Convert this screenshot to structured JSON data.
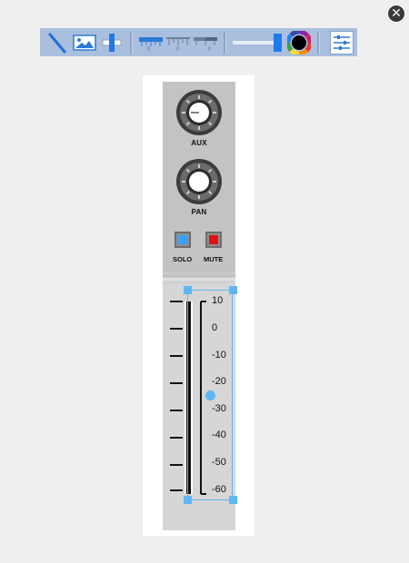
{
  "window": {
    "close_icon": "close-circle-icon"
  },
  "toolbar": {
    "tools": [
      {
        "name": "line-tool",
        "icon": "diagonal-line-icon"
      },
      {
        "name": "image-tool",
        "icon": "image-icon"
      },
      {
        "name": "slider-tool",
        "icon": "slider-icon"
      },
      {
        "name": "ruler-tool-1",
        "icon": "ruler-icon"
      },
      {
        "name": "ruler-tool-2",
        "icon": "ruler-icon"
      },
      {
        "name": "ruler-tool-3",
        "icon": "ruler-icon"
      },
      {
        "name": "range-slider",
        "icon": "range-slider-icon"
      },
      {
        "name": "color-wheel",
        "icon": "color-wheel-icon"
      },
      {
        "name": "mixer-settings",
        "icon": "mixer-sliders-icon"
      }
    ],
    "colors": {
      "background": "#a9bfdd",
      "accent": "#1e88e5"
    }
  },
  "channel": {
    "aux_label": "AUX",
    "pan_label": "PAN",
    "solo_label": "SOLO",
    "mute_label": "MUTE",
    "solo_color": "#3aa0f5",
    "mute_color": "#e01010",
    "scale": [
      "10",
      "0",
      "-10",
      "-20",
      "-30",
      "-40",
      "-50",
      "-60"
    ],
    "selection_color": "#5fb6f4"
  }
}
